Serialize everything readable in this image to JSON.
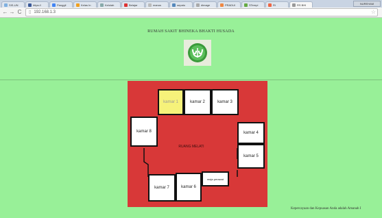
{
  "browser": {
    "tabs": [
      {
        "label": "SIS-UN",
        "color": "#7fb0e0"
      },
      {
        "label": "https://",
        "color": "#3b5998"
      },
      {
        "label": "Panggil",
        "color": "#4285f4"
      },
      {
        "label": "Kelas In",
        "color": "#f0a020"
      },
      {
        "label": "Kelolah",
        "color": "#8aa"
      },
      {
        "label": "Belajar",
        "color": "#d33"
      },
      {
        "label": "manus",
        "color": "#bbb"
      },
      {
        "label": "sepatu",
        "color": "#58b"
      },
      {
        "label": "dimage",
        "color": "#aaa"
      },
      {
        "label": "PRADUI",
        "color": "#e84"
      },
      {
        "label": "STempi",
        "color": "#6a4"
      },
      {
        "label": "Ri",
        "color": "#e64"
      },
      {
        "label": "RS BHI",
        "color": "#999"
      }
    ],
    "window_label": "NUREHAM",
    "back": "←",
    "forward": "→",
    "reload": "C",
    "url": "192.168.1.3",
    "star": "☆"
  },
  "header": {
    "title": "RUMAH SAKIT BHINEKA BHAKTI HUSADA"
  },
  "floorplan": {
    "colors": {
      "background": "#d83838",
      "active_room": "#f6f27a"
    },
    "center_label": "RUANG MELATI",
    "rooms": [
      {
        "label": "kamar 1",
        "active": true
      },
      {
        "label": "kamar 2",
        "active": false
      },
      {
        "label": "kamar 3",
        "active": false
      },
      {
        "label": "kamar 8",
        "active": false
      },
      {
        "label": "kamar 4",
        "active": false
      },
      {
        "label": "kamar 5",
        "active": false
      },
      {
        "label": "meja perawat",
        "active": false
      },
      {
        "label": "kamar 7",
        "active": false
      },
      {
        "label": "kamar 6",
        "active": false
      }
    ]
  },
  "footer": {
    "text": "Kepercayaan dan Kepuasan Anda adalah Amanah I"
  }
}
